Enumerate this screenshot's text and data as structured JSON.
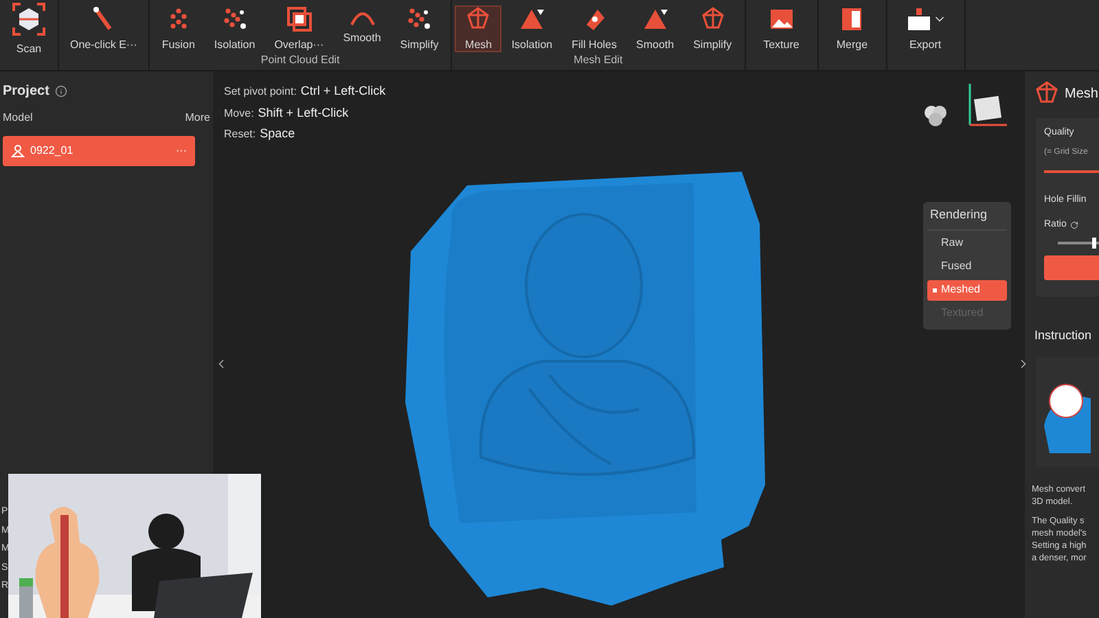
{
  "toolbar": {
    "standalone": [
      {
        "label": "Scan",
        "selected": false
      },
      {
        "label": "One-click E···",
        "selected": false
      }
    ],
    "groups": [
      {
        "caption": "Point Cloud Edit",
        "tools": [
          {
            "label": "Fusion",
            "selected": false
          },
          {
            "label": "Isolation",
            "selected": false
          },
          {
            "label": "Overlap···",
            "selected": false
          },
          {
            "label": "Smooth",
            "selected": false
          },
          {
            "label": "Simplify",
            "selected": false
          }
        ]
      },
      {
        "caption": "Mesh Edit",
        "tools": [
          {
            "label": "Mesh",
            "selected": true
          },
          {
            "label": "Isolation",
            "selected": false
          },
          {
            "label": "Fill Holes",
            "selected": false
          },
          {
            "label": "Smooth",
            "selected": false
          },
          {
            "label": "Simplify",
            "selected": false
          }
        ]
      }
    ],
    "trailing": [
      {
        "label": "Texture",
        "selected": false
      },
      {
        "label": "Merge",
        "selected": false
      },
      {
        "label": "Export",
        "selected": false
      }
    ]
  },
  "project": {
    "title": "Project",
    "model_header": "Model",
    "more": "More",
    "models": [
      {
        "name": "0922_01",
        "menu": "···",
        "selected": true
      }
    ],
    "panel_labels": [
      "P",
      "M",
      "M",
      "S",
      "R"
    ]
  },
  "hints": [
    {
      "label": "Set pivot point:",
      "keys": "Ctrl + Left-Click"
    },
    {
      "label": "Move:",
      "keys": "Shift + Left-Click"
    },
    {
      "label": "Reset:",
      "keys": "Space"
    }
  ],
  "rendering": {
    "title": "Rendering",
    "options": [
      {
        "label": "Raw",
        "selected": false,
        "disabled": false
      },
      {
        "label": "Fused",
        "selected": false,
        "disabled": false
      },
      {
        "label": "Meshed",
        "selected": true,
        "disabled": false
      },
      {
        "label": "Textured",
        "selected": false,
        "disabled": true
      }
    ]
  },
  "mesh_panel": {
    "title": "Mesh",
    "quality": "Quality",
    "grid_note": "(= Grid Size",
    "hole_filling": "Hole Fillin",
    "ratio": "Ratio"
  },
  "instructions": {
    "title": "Instruction",
    "paragraphs": [
      [
        "Mesh convert",
        "3D model."
      ],
      [
        "The Quality s",
        "mesh model's",
        "Setting a high",
        "a denser, mor"
      ]
    ]
  }
}
